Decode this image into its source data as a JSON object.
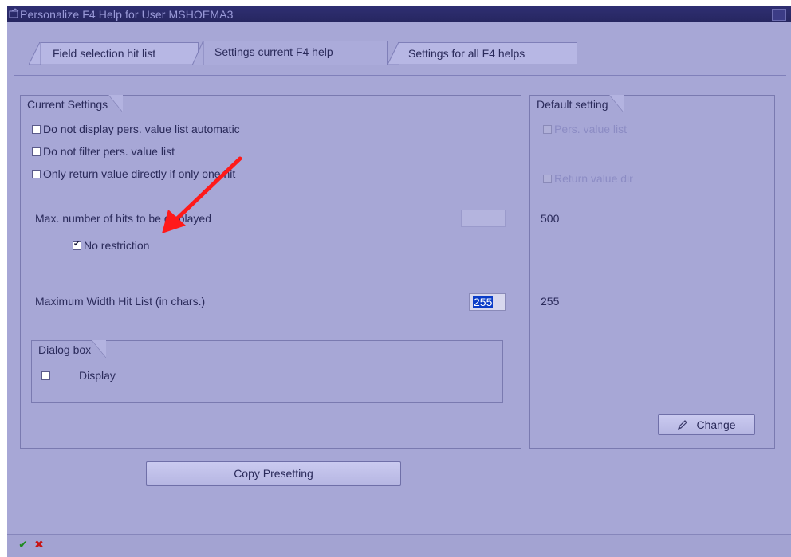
{
  "window": {
    "title": "Personalize F4 Help for User MSHOEMA3"
  },
  "tabs": [
    {
      "label": "Field selection hit list",
      "active": false
    },
    {
      "label": "Settings current F4 help",
      "active": true
    },
    {
      "label": "Settings for all F4 helps",
      "active": false
    }
  ],
  "current_settings": {
    "title": "Current Settings",
    "checkboxes": [
      {
        "label": "Do not display pers. value list automatic",
        "checked": false
      },
      {
        "label": "Do not filter pers. value list",
        "checked": false
      },
      {
        "label": "Only return value directly if only one hit",
        "checked": false
      }
    ],
    "max_hits": {
      "label": "Max. number of hits to be displayed",
      "value": ""
    },
    "no_restriction": {
      "label": "No restriction",
      "checked": true
    },
    "max_width": {
      "label": "Maximum Width Hit List (in chars.)",
      "value": "255"
    },
    "dialog_box": {
      "title": "Dialog box",
      "display": {
        "label": "Display",
        "checked": false
      }
    }
  },
  "default_setting": {
    "title": "Default setting",
    "pers_value_list": {
      "label": "Pers. value list",
      "checked": false
    },
    "return_value_dir": {
      "label": "Return value dir",
      "checked": false
    },
    "max_hits_value": "500",
    "max_width_value": "255",
    "change_button": "Change"
  },
  "copy_presetting_button": "Copy Presetting",
  "status_icons": {
    "confirm": "check-icon",
    "cancel": "cancel-x-icon"
  },
  "colors": {
    "background": "#a7a7d6",
    "titlebar": "#2b2b6a",
    "selection": "#0a3cc8",
    "annotation_arrow": "#ff1a1a"
  }
}
